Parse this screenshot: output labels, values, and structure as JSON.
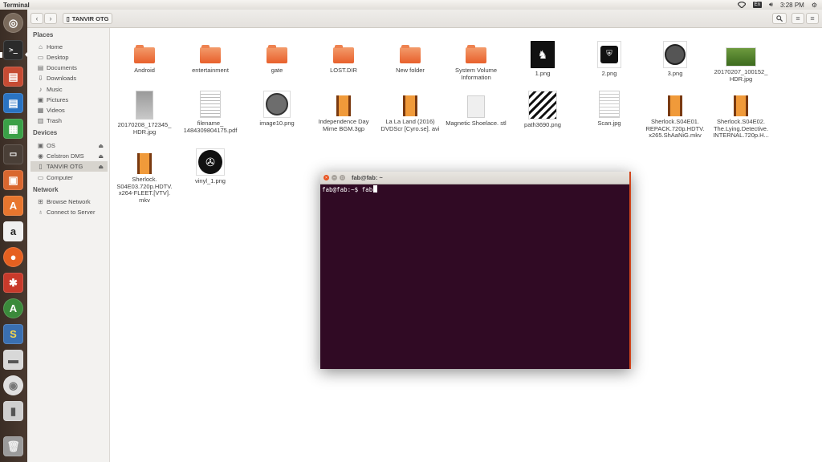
{
  "top_panel": {
    "app_title": "Terminal",
    "keyboard": "En",
    "clock": "3:28 PM"
  },
  "file_manager": {
    "path": "TANVIR OTG",
    "sidebar": {
      "places_header": "Places",
      "places": [
        "Home",
        "Desktop",
        "Documents",
        "Downloads",
        "Music",
        "Pictures",
        "Videos",
        "Trash"
      ],
      "devices_header": "Devices",
      "devices": [
        "OS",
        "Celstron DMS",
        "TANVIR OTG",
        "Computer"
      ],
      "network_header": "Network",
      "network": [
        "Browse Network",
        "Connect to Server"
      ]
    },
    "files": [
      {
        "name": "Android",
        "kind": "folder"
      },
      {
        "name": "entertainment",
        "kind": "folder"
      },
      {
        "name": "gate",
        "kind": "folder"
      },
      {
        "name": "LOST.DIR",
        "kind": "folder"
      },
      {
        "name": "New folder",
        "kind": "folder"
      },
      {
        "name": "System Volume Information",
        "kind": "folder"
      },
      {
        "name": "1.png",
        "kind": "image"
      },
      {
        "name": "2.png",
        "kind": "image"
      },
      {
        "name": "3.png",
        "kind": "image"
      },
      {
        "name": "20170207_100152_ HDR.jpg",
        "kind": "photo"
      },
      {
        "name": "20170208_172345_ HDR.jpg",
        "kind": "photo"
      },
      {
        "name": "filename_ 1484309804175.pdf",
        "kind": "document"
      },
      {
        "name": "image10.png",
        "kind": "image"
      },
      {
        "name": "Independence Day Mime BGM.3gp",
        "kind": "video"
      },
      {
        "name": "La La Land (2016) DVDScr [Cyro.se]. avi",
        "kind": "video"
      },
      {
        "name": "Magnetic Shoelace. stl",
        "kind": "document"
      },
      {
        "name": "path3690.png",
        "kind": "image"
      },
      {
        "name": "Scan.jpg",
        "kind": "document"
      },
      {
        "name": "Sherlock.S04E01. REPACK.720p.HDTV. x265.ShAaNiG.mkv",
        "kind": "video"
      },
      {
        "name": "Sherlock.S04E02. The.Lying.Detective. INTERNAL.720p.H...",
        "kind": "video"
      },
      {
        "name": "Sherlock. S04E03.720p.HDTV. x264-FLEET.[VTV]. mkv",
        "kind": "video"
      },
      {
        "name": "vinyl_1.png",
        "kind": "image"
      }
    ]
  },
  "terminal": {
    "title": "fab@fab: ~",
    "prompt": "fab@fab:~$ fab"
  },
  "colors": {
    "folder": "#e8602c",
    "terminal_bg": "#300a24",
    "launcher_bg": "#3a2d25"
  }
}
